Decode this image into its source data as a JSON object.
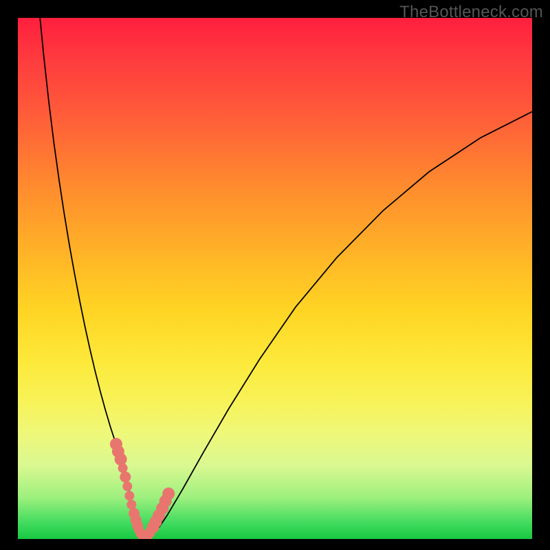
{
  "watermark": "TheBottleneck.com",
  "colors": {
    "frame": "#000000",
    "gradient_top": "#ff1f3e",
    "gradient_bottom": "#18c843",
    "curve": "#000000",
    "marker": "#e8766f"
  },
  "chart_data": {
    "type": "line",
    "title": "",
    "xlabel": "",
    "ylabel": "",
    "xlim": [
      0,
      100
    ],
    "ylim": [
      0,
      100
    ],
    "grid": false,
    "x": [
      4.3,
      5.0,
      6.0,
      7.0,
      8.0,
      9.0,
      10.0,
      11.0,
      12.0,
      13.0,
      14.0,
      15.0,
      16.0,
      17.0,
      18.0,
      19.0,
      20.0,
      20.9,
      21.6,
      22.3,
      23.0,
      23.8,
      24.6,
      25.5,
      27.0,
      29.0,
      32.0,
      36.0,
      41.0,
      47.0,
      54.0,
      62.0,
      71.0,
      80.0,
      90.0,
      100.0
    ],
    "y": [
      100.0,
      93.0,
      84.0,
      76.0,
      69.0,
      62.5,
      56.5,
      51.0,
      45.8,
      41.0,
      36.5,
      32.3,
      28.4,
      24.8,
      21.5,
      18.5,
      15.8,
      12.5,
      9.4,
      6.5,
      4.0,
      2.0,
      0.8,
      0.3,
      1.6,
      4.5,
      9.5,
      16.5,
      25.0,
      34.5,
      44.5,
      54.0,
      63.0,
      70.5,
      77.0,
      82.0
    ],
    "markers": {
      "x": [
        19.1,
        19.5,
        20.0,
        20.4,
        20.9,
        21.3,
        21.7,
        22.1,
        22.6,
        22.95,
        23.3,
        23.55,
        23.8,
        24.4,
        25.1,
        25.6,
        26.3,
        26.8,
        27.4,
        28.1,
        28.7,
        29.3
      ],
      "y": [
        18.2,
        16.8,
        15.3,
        13.6,
        11.9,
        10.1,
        8.3,
        6.6,
        4.9,
        3.6,
        2.5,
        1.7,
        1.1,
        0.6,
        0.6,
        1.2,
        2.3,
        3.3,
        4.5,
        5.9,
        7.3,
        8.7
      ],
      "r": [
        9,
        9,
        9,
        7,
        8,
        7,
        7,
        7,
        8,
        8,
        8,
        7,
        7,
        8,
        8,
        8,
        9,
        9,
        9,
        9,
        9,
        9
      ]
    }
  }
}
